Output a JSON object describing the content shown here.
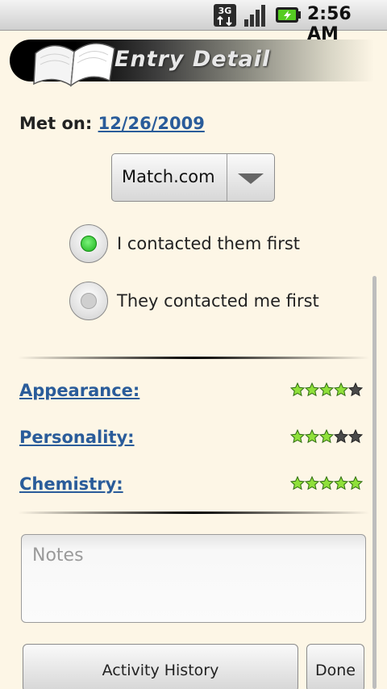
{
  "status_bar": {
    "network": "3G",
    "time": "2:56 AM"
  },
  "header": {
    "title": "Entry Detail"
  },
  "met": {
    "label": "Met on:",
    "date": "12/26/2009"
  },
  "source_spinner": {
    "selected": "Match.com"
  },
  "contact": {
    "options": [
      {
        "label": "I contacted them first",
        "selected": true
      },
      {
        "label": "They contacted me first",
        "selected": false
      }
    ]
  },
  "ratings": [
    {
      "label": "Appearance:",
      "stars": 4,
      "max": 5
    },
    {
      "label": "Personality:",
      "stars": 3,
      "max": 5
    },
    {
      "label": "Chemistry:",
      "stars": 5,
      "max": 5
    }
  ],
  "notes": {
    "placeholder": "Notes",
    "value": ""
  },
  "buttons": {
    "activity_history": "Activity History",
    "done": "Done"
  },
  "colors": {
    "background": "#fdf6e6",
    "link": "#2a5c9a",
    "star_on": "#8fe03a",
    "radio_on": "#1db31d"
  }
}
